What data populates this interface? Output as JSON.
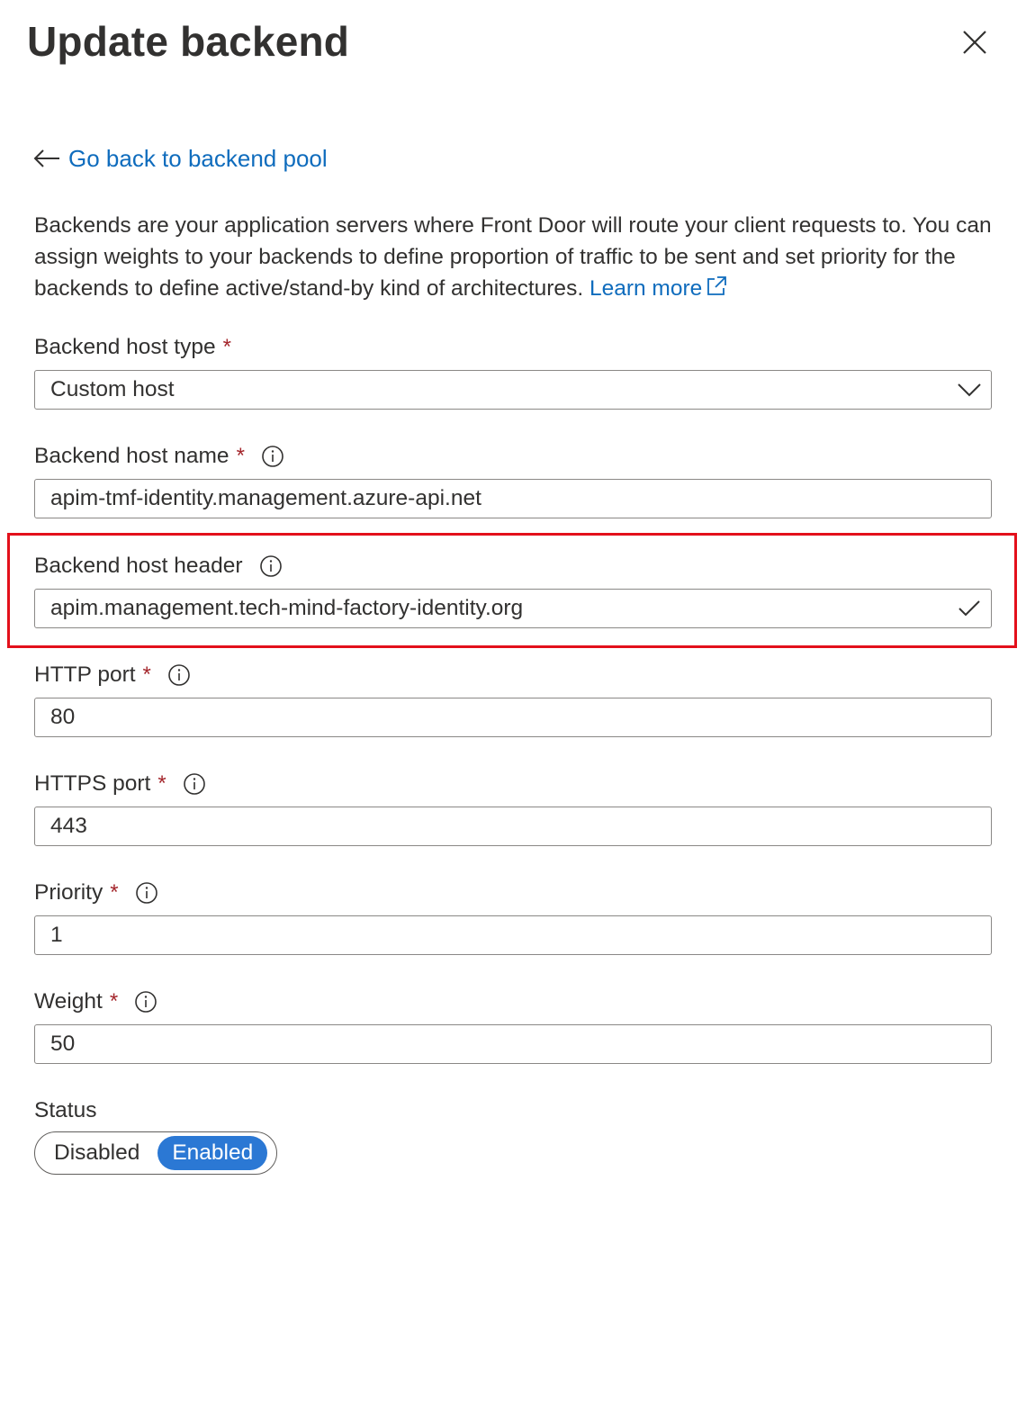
{
  "panel": {
    "title": "Update backend",
    "back_link": "Go back to backend pool",
    "description": "Backends are your application servers where Front Door will route your client requests to. You can assign weights to your backends to define proportion of traffic to be sent and set priority for the backends to define active/stand-by kind of architectures.",
    "learn_more": "Learn more",
    "link_color": "#0f6cbd",
    "highlight_color": "#e3101b"
  },
  "fields": {
    "host_type": {
      "label": "Backend host type",
      "required": "*",
      "value": "Custom host"
    },
    "host_name": {
      "label": "Backend host name",
      "required": "*",
      "value": "apim-tmf-identity.management.azure-api.net"
    },
    "host_header": {
      "label": "Backend host header",
      "value": "apim.management.tech-mind-factory-identity.org"
    },
    "http_port": {
      "label": "HTTP port",
      "required": "*",
      "value": "80"
    },
    "https_port": {
      "label": "HTTPS port",
      "required": "*",
      "value": "443"
    },
    "priority": {
      "label": "Priority",
      "required": "*",
      "value": "1"
    },
    "weight": {
      "label": "Weight",
      "required": "*",
      "value": "50"
    }
  },
  "status": {
    "label": "Status",
    "options": [
      "Disabled",
      "Enabled"
    ],
    "selected": "Enabled",
    "selected_color": "#2b78d4"
  },
  "icons": {
    "close": "close-icon",
    "back": "arrow-left-icon",
    "external": "external-link-icon",
    "info": "info-icon",
    "dropdown": "chevron-down-icon",
    "valid": "checkmark-icon"
  }
}
